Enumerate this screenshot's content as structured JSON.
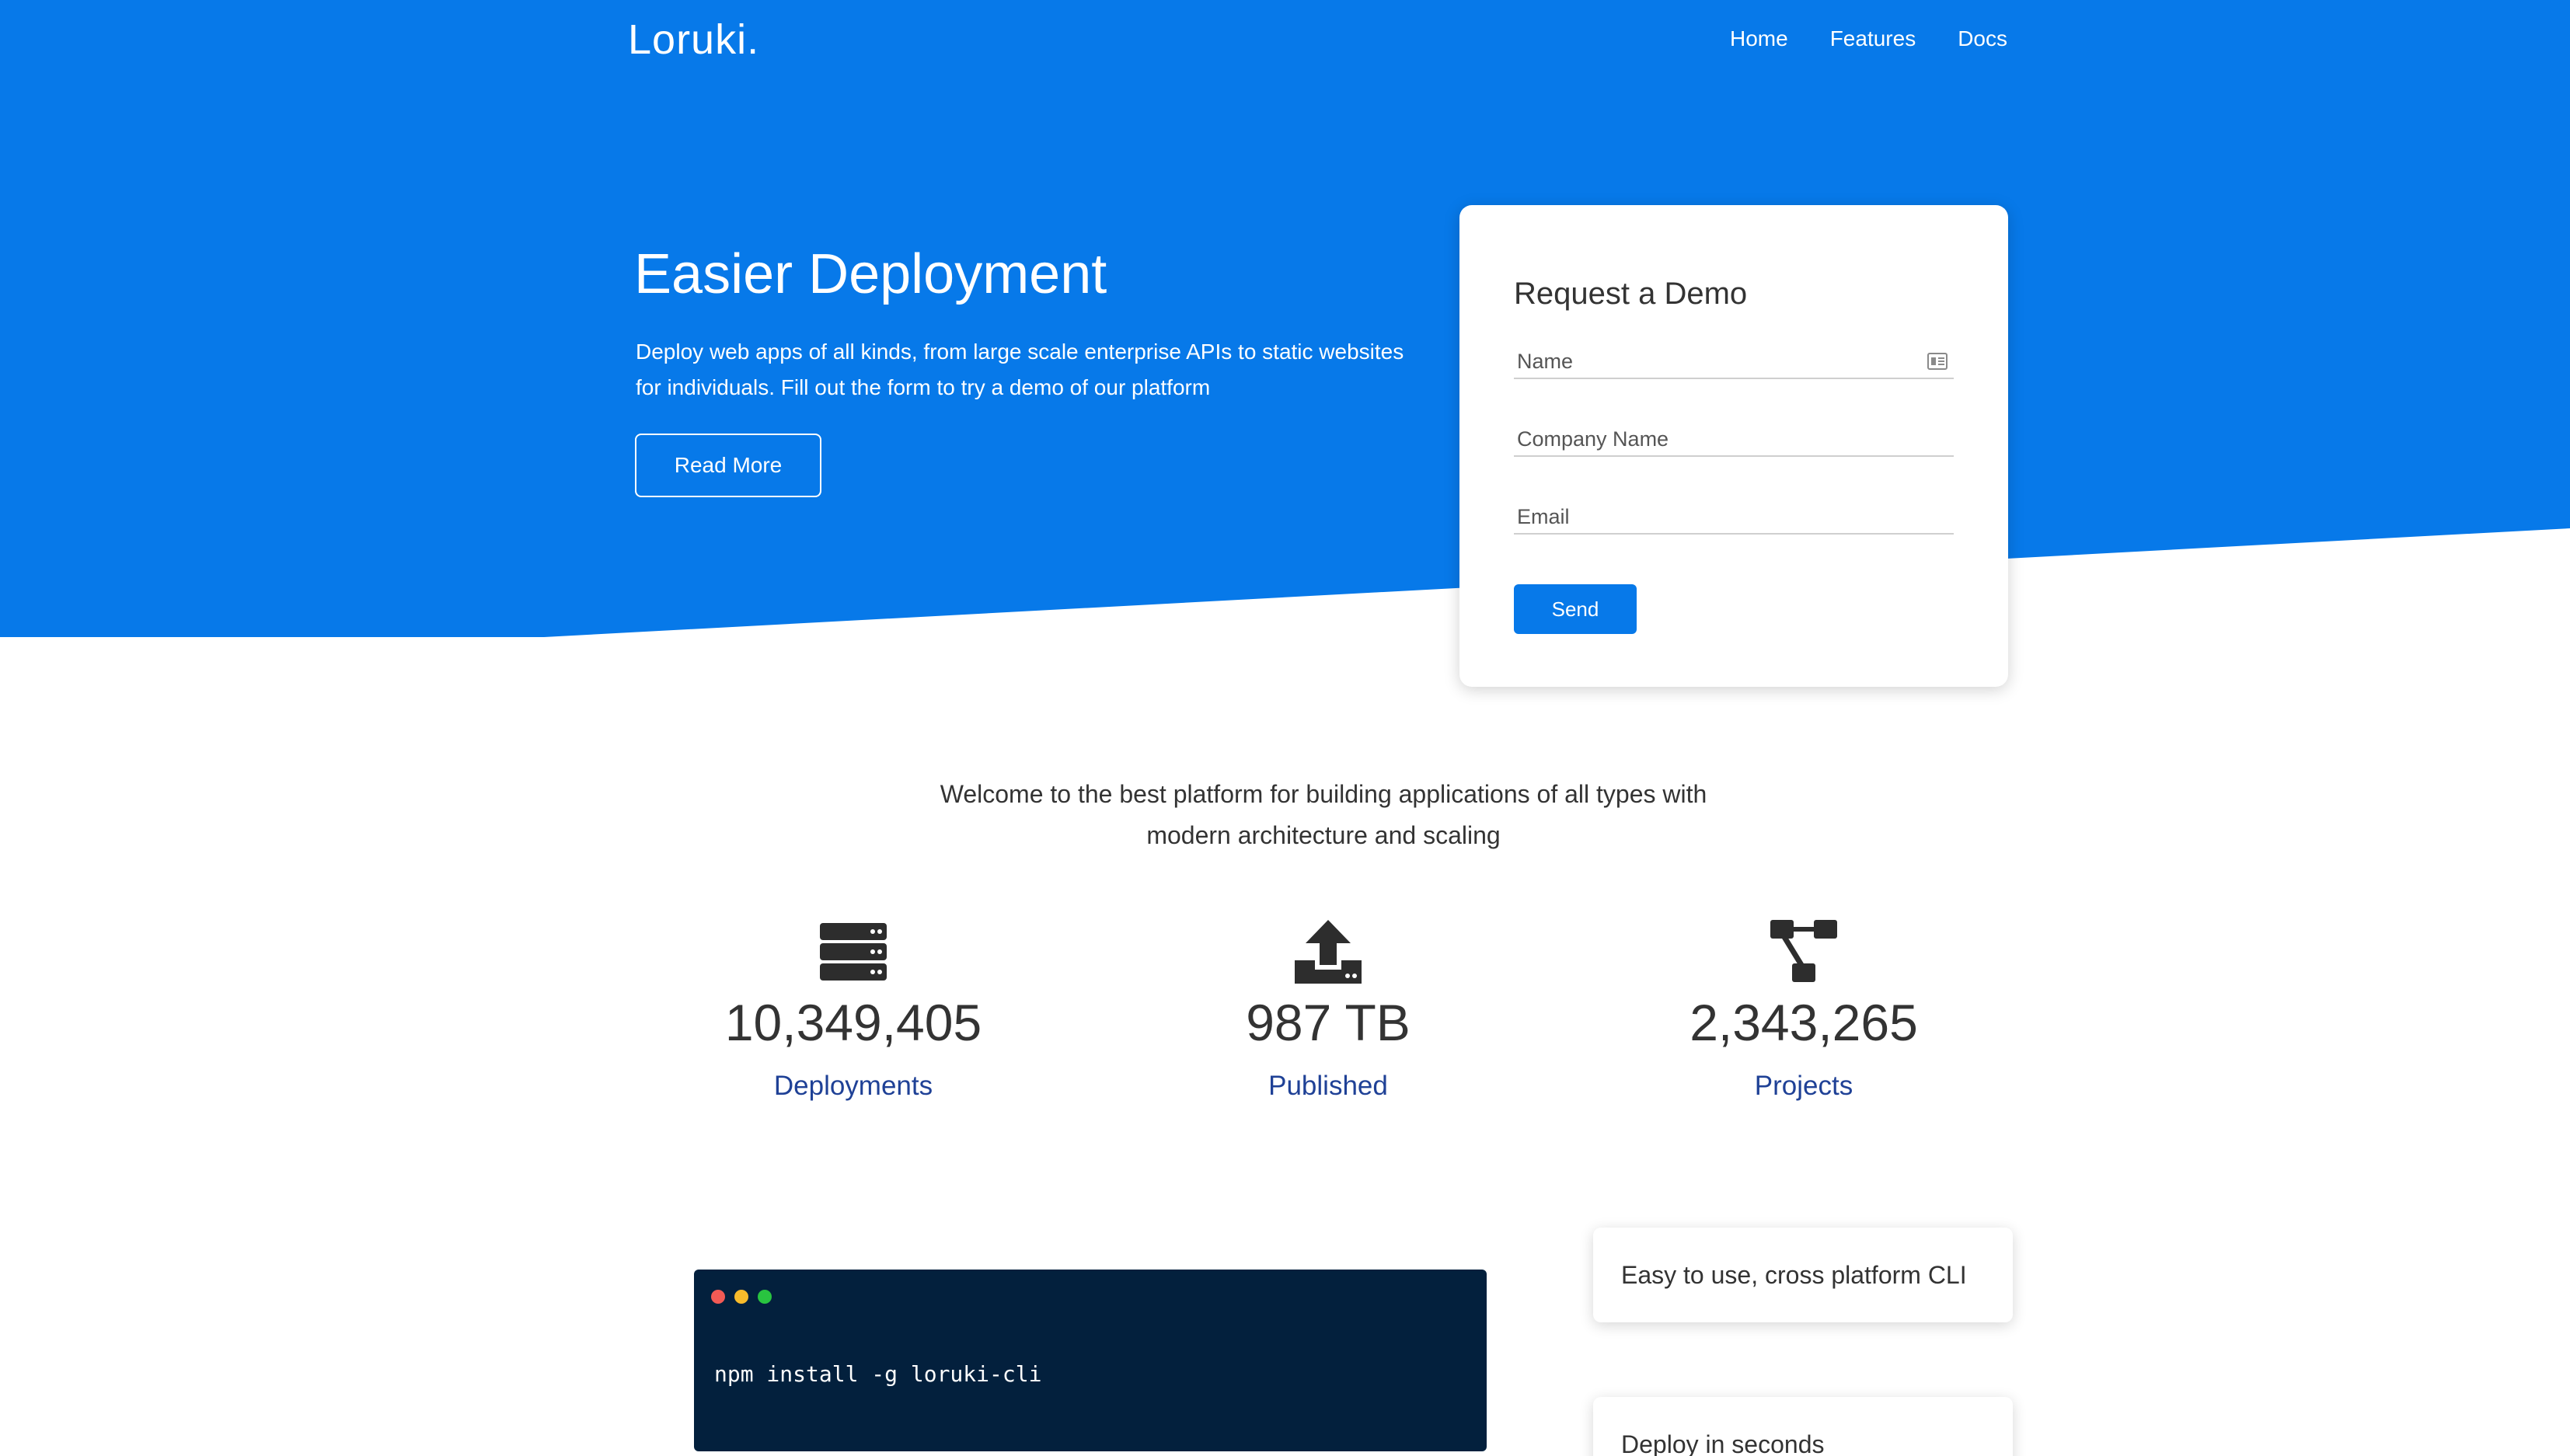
{
  "brand": {
    "logo": "Loruki."
  },
  "nav": {
    "items": [
      {
        "label": "Home"
      },
      {
        "label": "Features"
      },
      {
        "label": "Docs"
      }
    ]
  },
  "hero": {
    "title": "Easier Deployment",
    "description": "Deploy web apps of all kinds, from large scale enterprise APIs to static websites for individuals. Fill out the form to try a demo of our platform",
    "read_more_label": "Read More"
  },
  "demo_form": {
    "title": "Request a Demo",
    "name_placeholder": "Name",
    "company_placeholder": "Company Name",
    "email_placeholder": "Email",
    "send_label": "Send"
  },
  "welcome": {
    "text": "Welcome to the best platform for building applications of all types with modern architecture and scaling"
  },
  "stats": [
    {
      "icon": "server-icon",
      "value": "10,349,405",
      "label": "Deployments"
    },
    {
      "icon": "upload-icon",
      "value": "987 TB",
      "label": "Published"
    },
    {
      "icon": "project-diagram-icon",
      "value": "2,343,265",
      "label": "Projects"
    }
  ],
  "terminal": {
    "command": "npm install -g loruki-cli",
    "dot_colors": [
      "#f25a55",
      "#f8bb2b",
      "#29c440"
    ],
    "background": "#03203d"
  },
  "features": [
    {
      "label": "Easy to use, cross platform CLI"
    },
    {
      "label": "Deploy in seconds"
    }
  ],
  "colors": {
    "primary": "#0779e9",
    "stat_label": "#1f4196"
  }
}
